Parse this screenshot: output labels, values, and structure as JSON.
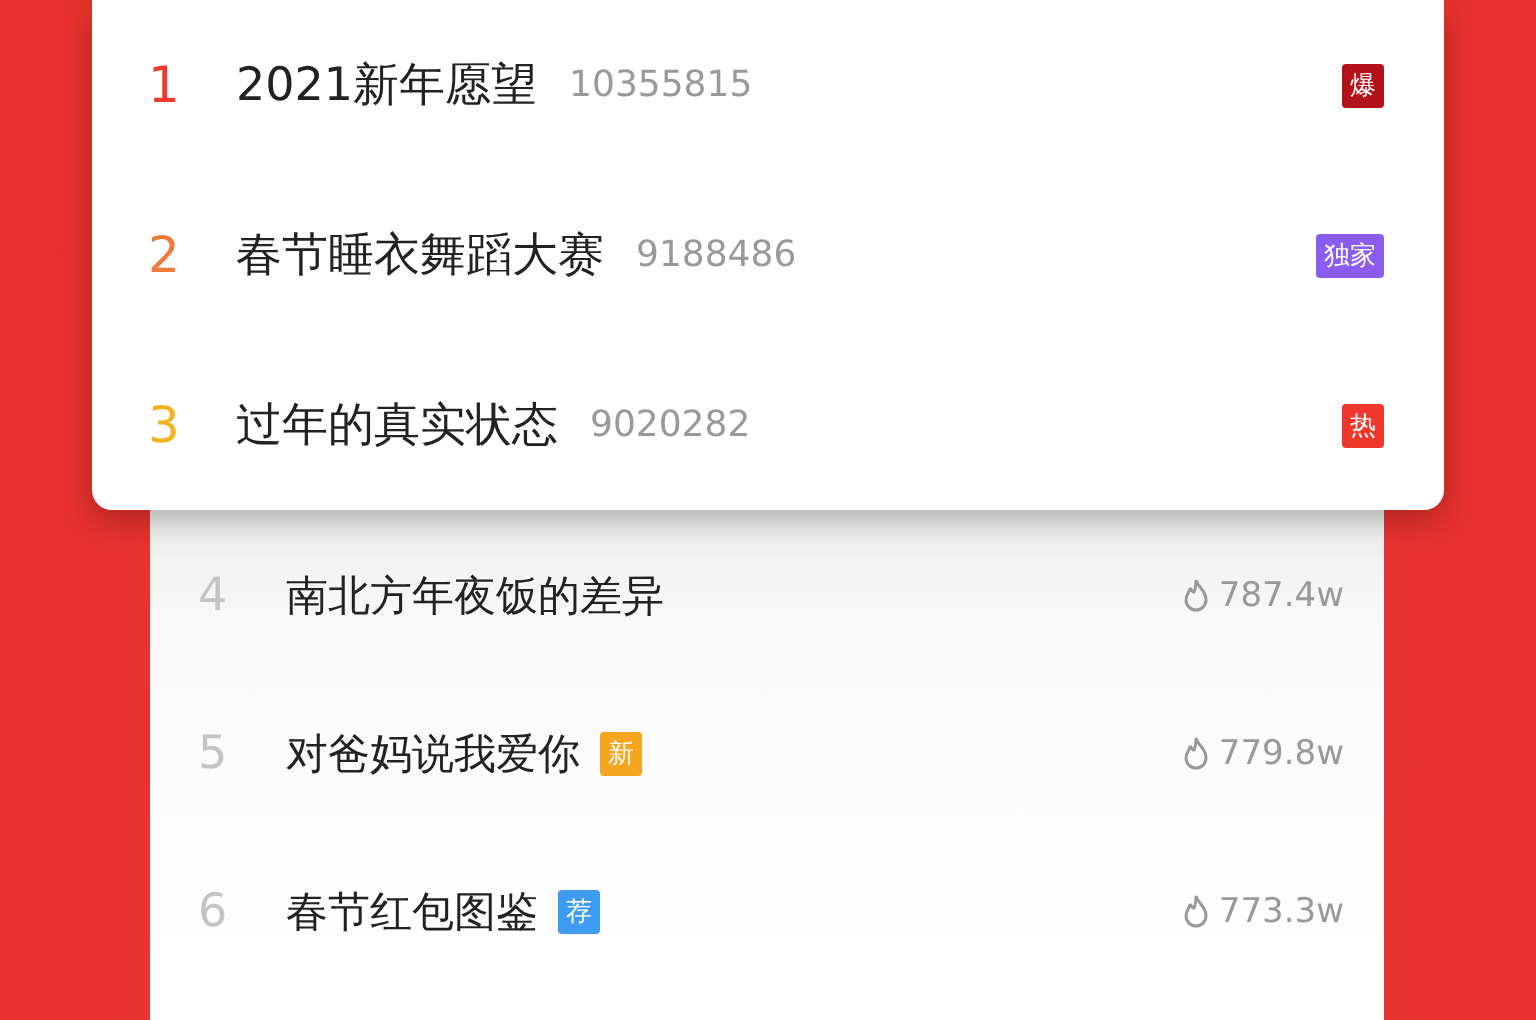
{
  "featured": [
    {
      "rank": "1",
      "color": "#ee3b32",
      "title": "2021新年愿望",
      "count": "10355815",
      "badge": {
        "text": "爆",
        "color": "#b3121a"
      }
    },
    {
      "rank": "2",
      "color": "#f07a3a",
      "title": "春节睡衣舞蹈大赛",
      "count": "9188486",
      "badge": {
        "text": "独家",
        "color": "#8b5cf0"
      }
    },
    {
      "rank": "3",
      "color": "#f5b21e",
      "title": "过年的真实状态",
      "count": "9020282",
      "badge": {
        "text": "热",
        "color": "#f0372c"
      }
    }
  ],
  "list": [
    {
      "rank": "4",
      "title": "南北方年夜饭的差异",
      "heat": "787.4w"
    },
    {
      "rank": "5",
      "title": "对爸妈说我爱你",
      "badge": {
        "text": "新",
        "color": "#f5a51e"
      },
      "heat": "779.8w"
    },
    {
      "rank": "6",
      "title": "春节红包图鉴",
      "badge": {
        "text": "荐",
        "color": "#3d9cf2"
      },
      "heat": "773.3w"
    }
  ]
}
